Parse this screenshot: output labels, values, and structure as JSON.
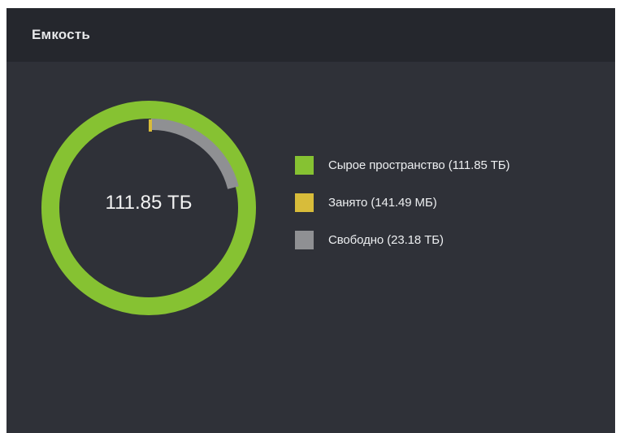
{
  "panel": {
    "title": "Емкость"
  },
  "chart_data": {
    "type": "donut",
    "center_label": "111.85 ТБ",
    "series": [
      {
        "name": "Сырое пространство (111.85 ТБ)",
        "value_tb": 111.85,
        "color": "#86c232"
      },
      {
        "name": "Занято (141.49 МБ)",
        "value_mb": 141.49,
        "color": "#d8bc3a"
      },
      {
        "name": "Свободно (23.18 ТБ)",
        "value_tb": 23.18,
        "color": "#8f9093"
      }
    ]
  },
  "legend": {
    "items": [
      {
        "label": "Сырое пространство (111.85 ТБ)",
        "color": "#86c232"
      },
      {
        "label": "Занято (141.49 МБ)",
        "color": "#d8bc3a"
      },
      {
        "label": "Свободно (23.18 ТБ)",
        "color": "#8f9093"
      }
    ]
  }
}
